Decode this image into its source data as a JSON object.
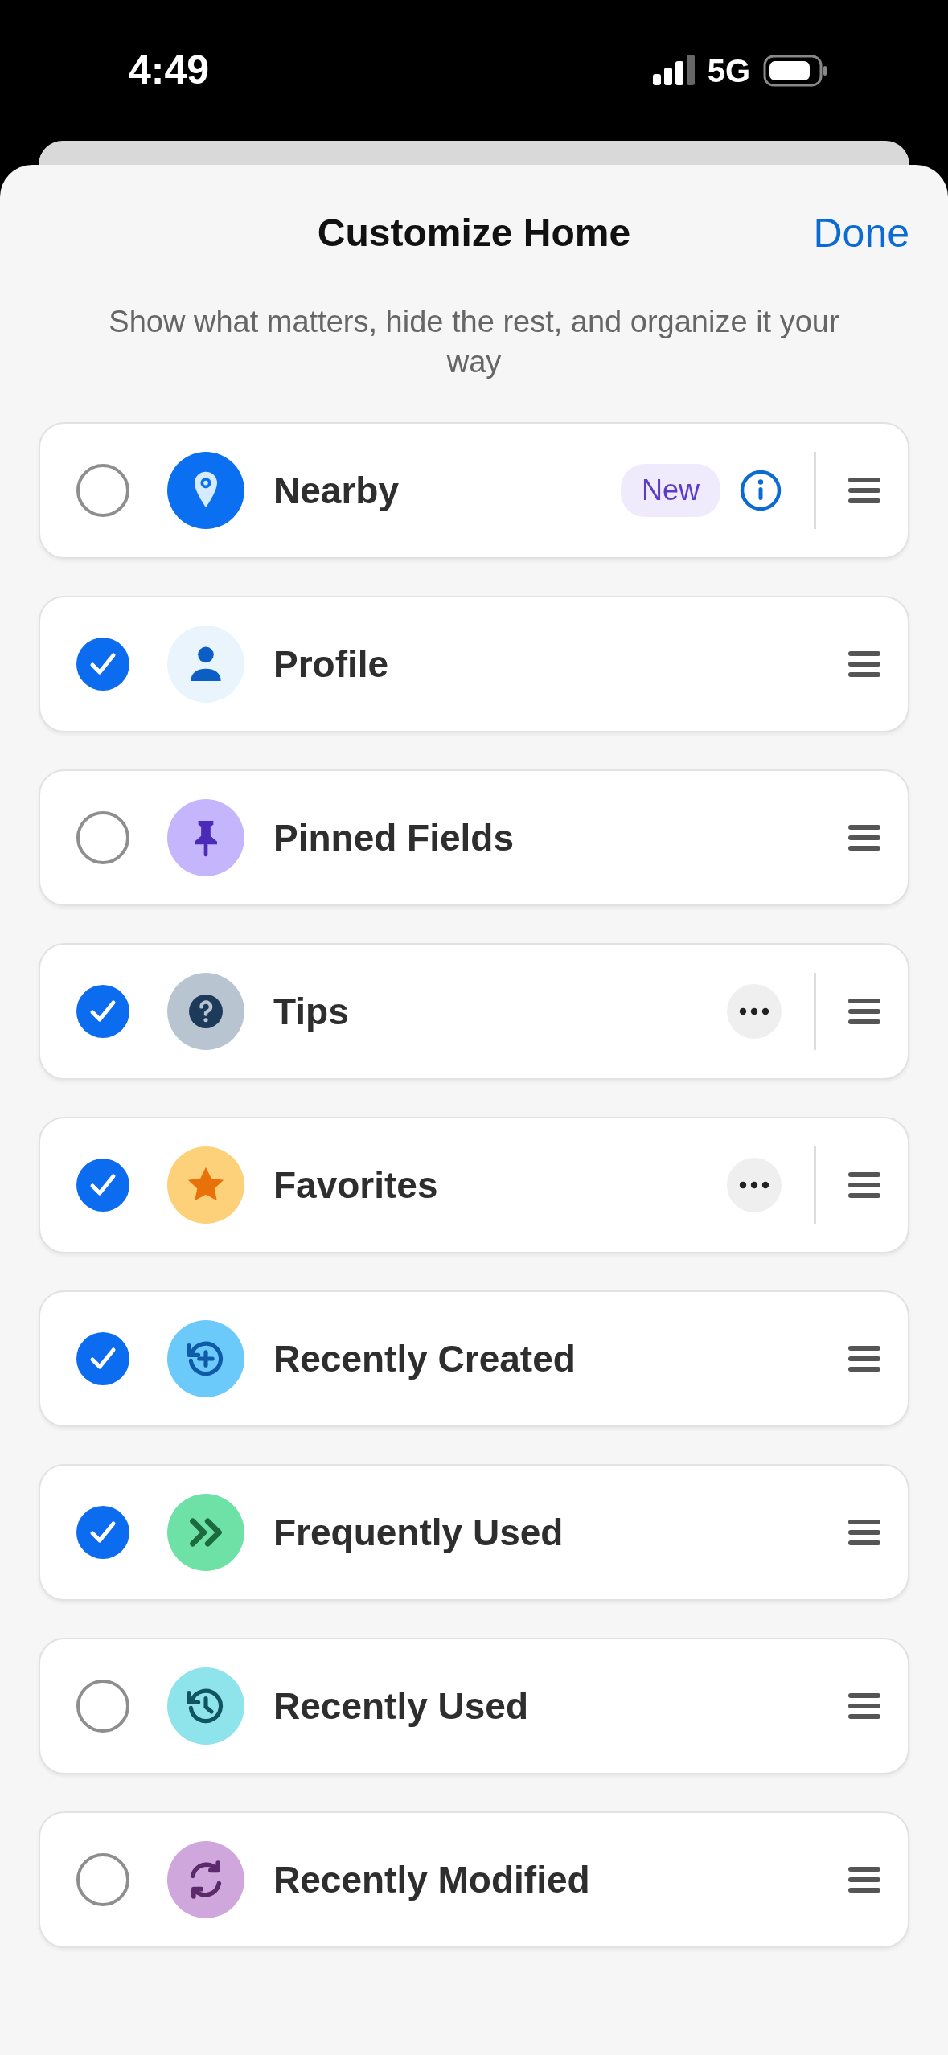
{
  "status_bar": {
    "time": "4:49",
    "network": "5G"
  },
  "header": {
    "title": "Customize Home",
    "done": "Done"
  },
  "subtitle": "Show what matters, hide the rest, and organize it your way",
  "items": [
    {
      "label": "Nearby",
      "checked": false,
      "color": "#0a6ff0",
      "badge": "New",
      "info": true,
      "more": false
    },
    {
      "label": "Profile",
      "checked": true,
      "color": "#eaf4fd",
      "info": false,
      "more": false
    },
    {
      "label": "Pinned Fields",
      "checked": false,
      "color": "#c4b5fd",
      "info": false,
      "more": false
    },
    {
      "label": "Tips",
      "checked": true,
      "color": "#b8c4d0",
      "info": false,
      "more": true
    },
    {
      "label": "Favorites",
      "checked": true,
      "color": "#fdd07a",
      "info": false,
      "more": true
    },
    {
      "label": "Recently Created",
      "checked": true,
      "color": "#6ccafb",
      "info": false,
      "more": false
    },
    {
      "label": "Frequently Used",
      "checked": true,
      "color": "#6ee2a6",
      "info": false,
      "more": false
    },
    {
      "label": "Recently Used",
      "checked": false,
      "color": "#8fe3ea",
      "info": false,
      "more": false
    },
    {
      "label": "Recently Modified",
      "checked": false,
      "color": "#cfa7dc",
      "info": false,
      "more": false
    }
  ]
}
